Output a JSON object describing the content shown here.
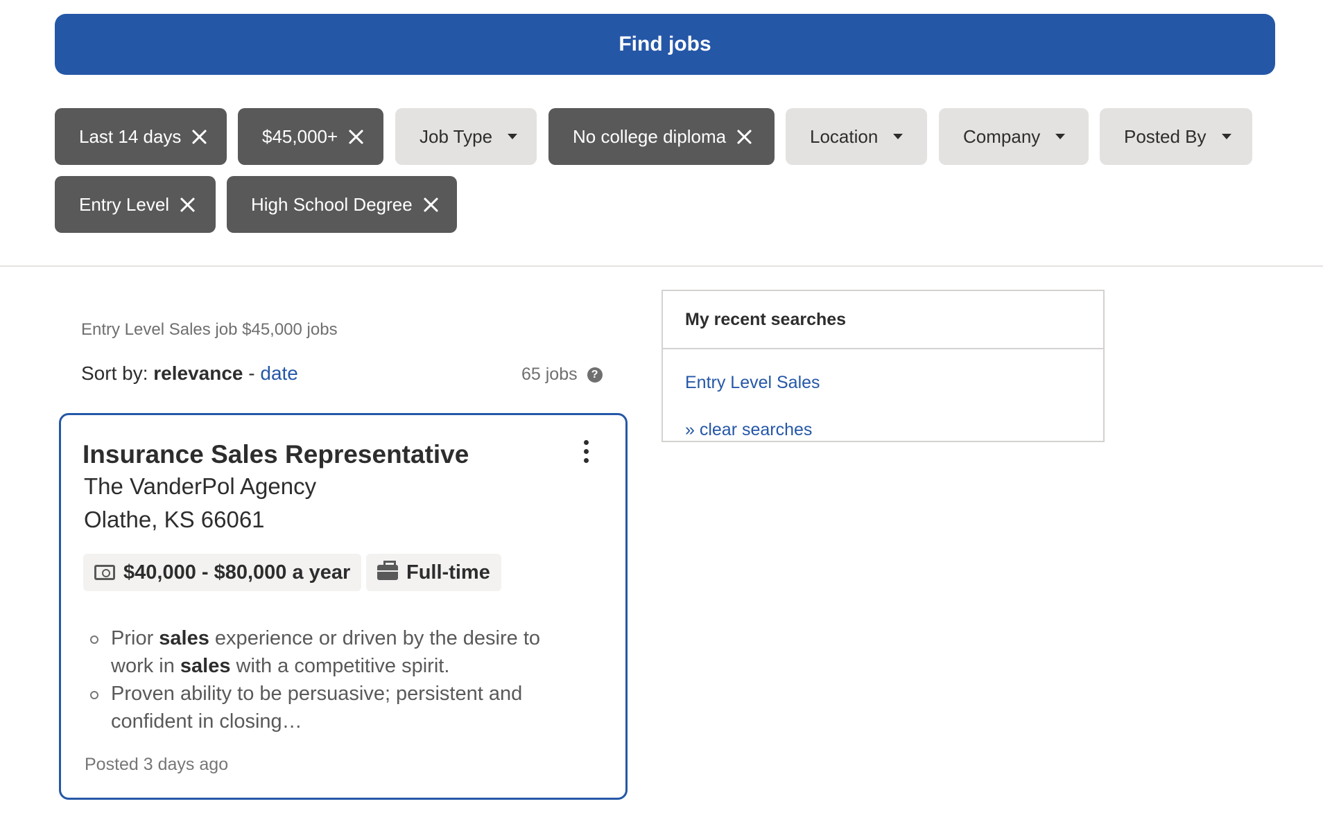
{
  "search": {
    "find_label": "Find jobs"
  },
  "filters": {
    "row1": [
      {
        "label": "Last 14 days",
        "active": true
      },
      {
        "label": "$45,000+",
        "active": true
      },
      {
        "label": "Job Type",
        "active": false
      },
      {
        "label": "No college diploma",
        "active": true
      },
      {
        "label": "Location",
        "active": false
      },
      {
        "label": "Company",
        "active": false
      },
      {
        "label": "Posted By",
        "active": false
      }
    ],
    "row2": [
      {
        "label": "Entry Level",
        "active": true
      },
      {
        "label": "High School Degree",
        "active": true
      }
    ]
  },
  "results": {
    "query_text": "Entry Level Sales job $45,000 jobs",
    "sort_label": "Sort by:",
    "sort_active": "relevance",
    "sort_separator": "-",
    "sort_alt": "date",
    "count": "65 jobs",
    "help_glyph": "?"
  },
  "job": {
    "title": "Insurance Sales Representative",
    "company": "The VanderPol Agency",
    "location": "Olathe, KS 66061",
    "salary": "$40,000 - $80,000 a year",
    "job_type": "Full-time",
    "snippet": {
      "b1_pre": "Prior ",
      "b1_k1": "sales",
      "b1_mid": " experience or driven by the desire to work in ",
      "b1_k2": "sales",
      "b1_post": " with a competitive spirit.",
      "b2": "Proven ability to be persuasive; persistent and confident in closing…"
    },
    "posted": "Posted 3 days ago"
  },
  "recent": {
    "title": "My recent searches",
    "items": [
      "Entry Level Sales"
    ],
    "clear_label": "» clear searches"
  },
  "colors": {
    "accent": "#2557a7",
    "chip_active": "#595959",
    "chip_inactive": "#e4e2e0"
  }
}
